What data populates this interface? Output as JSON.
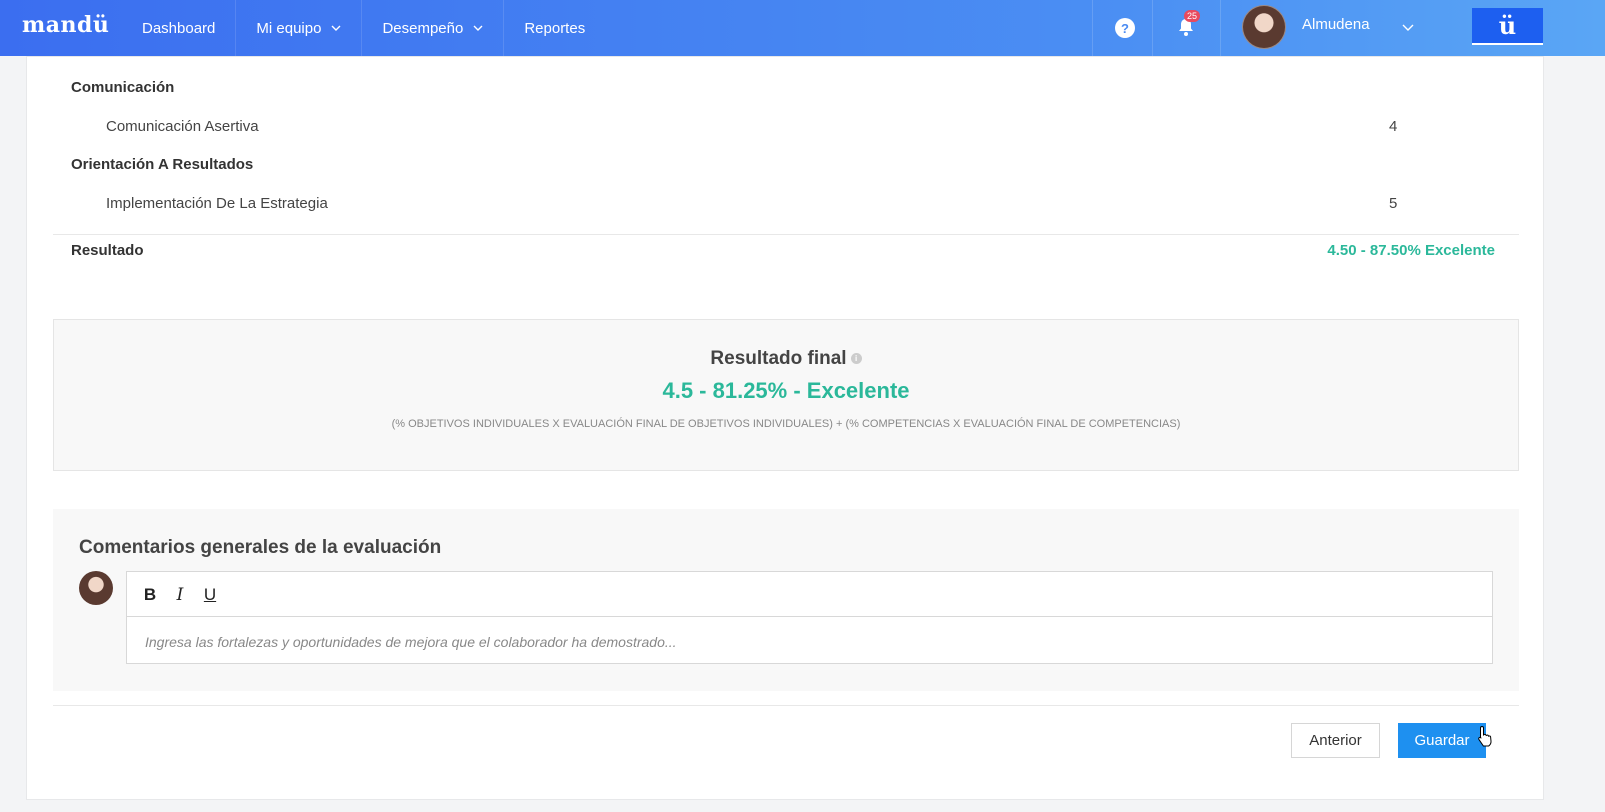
{
  "nav": {
    "logo": "mandü",
    "items": [
      {
        "label": "Dashboard",
        "has_dropdown": false
      },
      {
        "label": "Mi equipo",
        "has_dropdown": true
      },
      {
        "label": "Desempeño",
        "has_dropdown": true
      },
      {
        "label": "Reportes",
        "has_dropdown": false
      }
    ],
    "help_icon": "?",
    "notifications_count": "25",
    "user_name": "Almudena",
    "brand_button": "ü"
  },
  "competencias": {
    "groups": [
      {
        "category": "Comunicación",
        "sub": "Comunicación Asertiva",
        "value": "4"
      },
      {
        "category": "Orientación A Resultados",
        "sub": "Implementación De La Estrategia",
        "value": "5"
      }
    ],
    "result_label": "Resultado",
    "result_value": "4.50 - 87.50% Excelente"
  },
  "final": {
    "title": "Resultado final",
    "value": "4.5 - 81.25% - Excelente",
    "formula": "(% OBJETIVOS INDIVIDUALES X EVALUACIÓN FINAL DE OBJETIVOS INDIVIDUALES) + (% COMPETENCIAS X EVALUACIÓN FINAL DE COMPETENCIAS)"
  },
  "comments": {
    "title": "Comentarios generales de la evaluación",
    "toolbar": {
      "bold": "B",
      "italic": "I",
      "underline": "U"
    },
    "placeholder": "Ingresa las fortalezas y oportunidades de mejora que el colaborador ha demostrado..."
  },
  "actions": {
    "previous": "Anterior",
    "save": "Guardar"
  },
  "colors": {
    "nav_start": "#3b6ef0",
    "nav_end": "#5aa6f5",
    "success": "#2bb89a",
    "primary": "#1e90f0"
  }
}
